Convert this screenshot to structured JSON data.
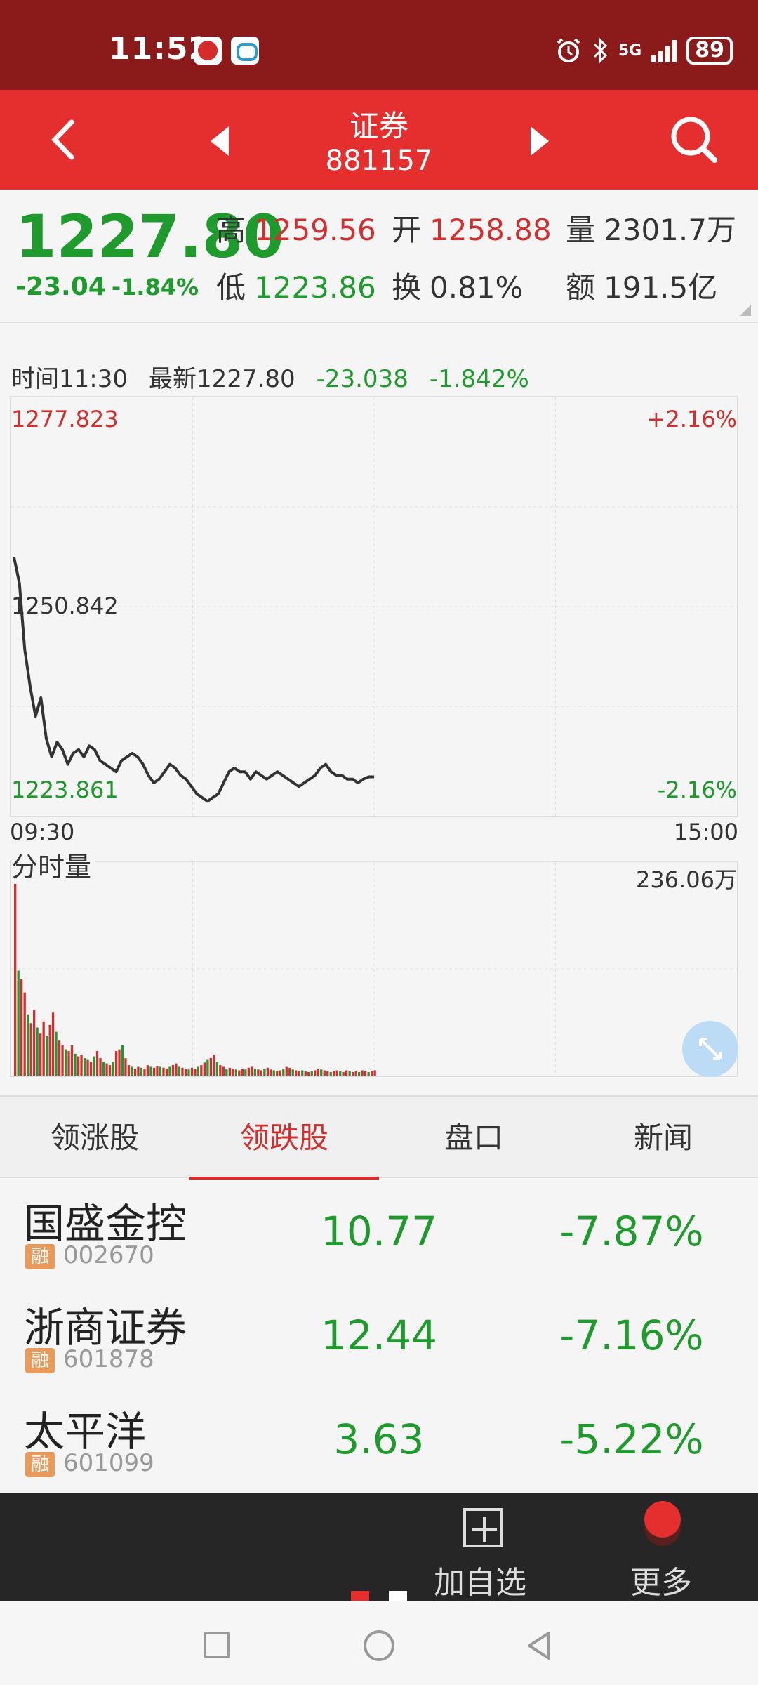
{
  "status_bar": {
    "time": "11:52",
    "network": "5G",
    "battery": "89"
  },
  "header": {
    "title": "证券",
    "code": "881157"
  },
  "quote": {
    "price": "1227.80",
    "change": "-23.04",
    "change_pct": "-1.84%",
    "high_label": "高",
    "high": "1259.56",
    "open_label": "开",
    "open": "1258.88",
    "volume_label": "量",
    "volume": "2301.7万",
    "low_label": "低",
    "low": "1223.86",
    "turnover_label": "换",
    "turnover": "0.81%",
    "amount_label": "额",
    "amount": "191.5亿"
  },
  "info_line": {
    "time": "时间11:30",
    "latest": "最新1227.80",
    "delta": "-23.038",
    "delta_pct": "-1.842%"
  },
  "intraday": {
    "y_max": "1277.823",
    "y_mid": "1250.842",
    "y_min": "1223.861",
    "pct_max": "+2.16%",
    "pct_min": "-2.16%",
    "x_start": "09:30",
    "x_end": "15:00",
    "volume_label": "分时量",
    "volume_max": "236.06万"
  },
  "chart_data": [
    {
      "type": "line",
      "ylim": [
        1223.861,
        1277.823
      ],
      "x_range": [
        "09:30",
        "15:00"
      ],
      "series": [
        {
          "values": [
            1257.5,
            1254.0,
            1245.0,
            1240.0,
            1236.0,
            1238.5,
            1233.0,
            1230.5,
            1232.5,
            1231.5,
            1229.5,
            1231.0,
            1231.5,
            1230.5,
            1232.0,
            1231.5,
            1230.0,
            1229.5,
            1229.0,
            1228.5,
            1230.0,
            1230.5,
            1231.0,
            1230.5,
            1229.5,
            1228.0,
            1227.0,
            1227.5,
            1228.5,
            1229.5,
            1229.0,
            1228.0,
            1227.5,
            1226.5,
            1225.5,
            1225.0,
            1224.5,
            1225.0,
            1225.5,
            1227.0,
            1228.5,
            1229.0,
            1228.5,
            1228.5,
            1227.5,
            1228.5,
            1228.0,
            1227.5,
            1228.0,
            1228.5,
            1228.0,
            1227.5,
            1227.0,
            1226.5,
            1227.0,
            1227.5,
            1228.0,
            1229.0,
            1229.5,
            1228.5,
            1228.0,
            1228.0,
            1227.5,
            1227.5,
            1227.0,
            1227.5,
            1227.8,
            1227.8
          ]
        }
      ]
    },
    {
      "type": "bar",
      "ylim": [
        0,
        236.06
      ],
      "x_range": [
        "09:30",
        "15:00"
      ],
      "series": [
        {
          "values": [
            236,
            120,
            110,
            95,
            70,
            60,
            75,
            55,
            48,
            62,
            45,
            58,
            72,
            50,
            40,
            35,
            30,
            28,
            35,
            25,
            22,
            24,
            20,
            18,
            16,
            22,
            28,
            20,
            16,
            14,
            12,
            16,
            28,
            30,
            35,
            20,
            12,
            10,
            8,
            10,
            9,
            8,
            12,
            10,
            9,
            11,
            10,
            9,
            8,
            10,
            12,
            14,
            10,
            9,
            8,
            7,
            9,
            8,
            10,
            12,
            15,
            18,
            20,
            24,
            16,
            12,
            10,
            8,
            9,
            8,
            7,
            6,
            8,
            7,
            9,
            10,
            8,
            7,
            6,
            8,
            9,
            7,
            6,
            5,
            6,
            8,
            10,
            9,
            7,
            6,
            5,
            6,
            5,
            4,
            5,
            6,
            8,
            7,
            6,
            5,
            4,
            5,
            6,
            5,
            4,
            6,
            5,
            4,
            5,
            4,
            6,
            5,
            4,
            5,
            6
          ]
        }
      ]
    }
  ],
  "tabs": [
    "领涨股",
    "领跌股",
    "盘口",
    "新闻"
  ],
  "stocks": [
    {
      "name": "国盛金控",
      "tag": "融",
      "code": "002670",
      "price": "10.77",
      "pct": "-7.87%"
    },
    {
      "name": "浙商证券",
      "tag": "融",
      "code": "601878",
      "price": "12.44",
      "pct": "-7.16%"
    },
    {
      "name": "太平洋",
      "tag": "融",
      "code": "601099",
      "price": "3.63",
      "pct": "-5.22%"
    }
  ],
  "bottom": {
    "add_label": "加自选",
    "more_label": "更多"
  },
  "colors": {
    "up": "#d42f2f",
    "down": "#1f9a2d",
    "header": "#e52f2f",
    "status": "#8b1a1a"
  }
}
